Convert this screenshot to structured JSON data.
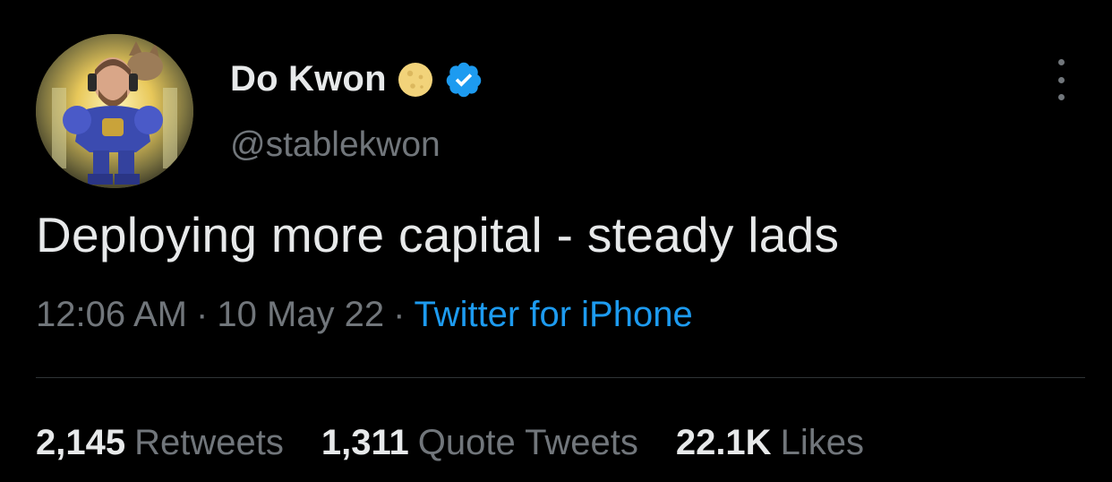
{
  "author": {
    "display_name": "Do Kwon",
    "handle": "@stablekwon",
    "badges": [
      "moon-icon",
      "verified-icon"
    ],
    "verified_color": "#1d9bf0"
  },
  "tweet": {
    "text": "Deploying more capital - steady lads",
    "time": "12:06 AM",
    "separator": "·",
    "date": "10 May 22",
    "source": "Twitter for iPhone"
  },
  "stats": [
    {
      "count": "2,145",
      "label": "Retweets"
    },
    {
      "count": "1,311",
      "label": "Quote Tweets"
    },
    {
      "count": "22.1K",
      "label": "Likes"
    }
  ],
  "colors": {
    "background": "#000000",
    "primary_text": "#e7e9ea",
    "secondary_text": "#71767b",
    "link": "#1d9bf0",
    "divider": "#2f3336"
  }
}
